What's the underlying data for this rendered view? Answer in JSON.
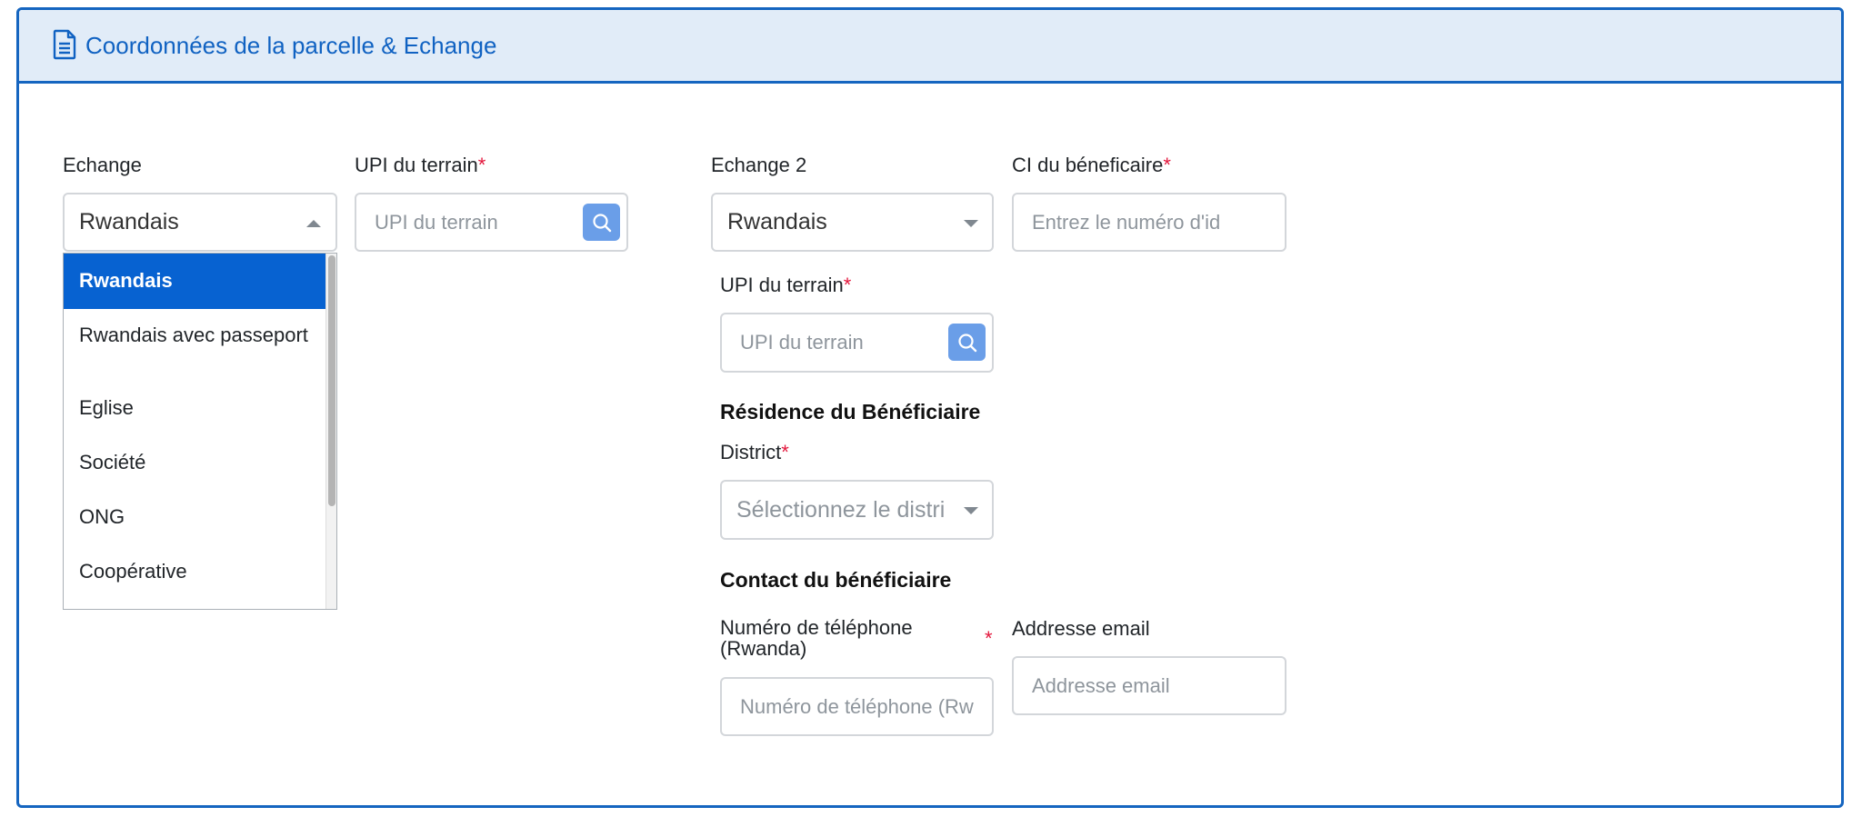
{
  "header": {
    "title": "Coordonnées de la parcelle & Echange",
    "icon": "document-icon"
  },
  "left": {
    "echange_label": "Echange",
    "echange_value": "Rwandais",
    "upi_label": "UPI du terrain",
    "upi_placeholder": "UPI du terrain",
    "dropdown_options": [
      "Rwandais",
      "Rwandais avec passeport",
      "Eglise",
      "Société",
      "ONG",
      "Coopérative"
    ]
  },
  "right": {
    "echange2_label": "Echange 2",
    "echange2_value": "Rwandais",
    "ci_label": "CI du béneficaire",
    "ci_placeholder": "Entrez le numéro d'id",
    "upi_label": "UPI du terrain",
    "upi_placeholder": "UPI du terrain",
    "residence_title": "Résidence du Bénéficiaire",
    "district_label": "District",
    "district_placeholder": "Sélectionnez le distri",
    "contact_title": "Contact du bénéficiaire",
    "phone_label_line1": "Numéro de téléphone",
    "phone_label_line2": "(Rwanda)",
    "phone_placeholder": "Numéro de téléphone (Rw",
    "email_label": "Addresse email",
    "email_placeholder": "Addresse email"
  },
  "required_marker": "*",
  "colors": {
    "accent": "#1565c0",
    "header_bg": "#e1ecf8",
    "selected_option": "#0762d1",
    "search_button": "#6a9ee8",
    "required": "#e3173c"
  }
}
